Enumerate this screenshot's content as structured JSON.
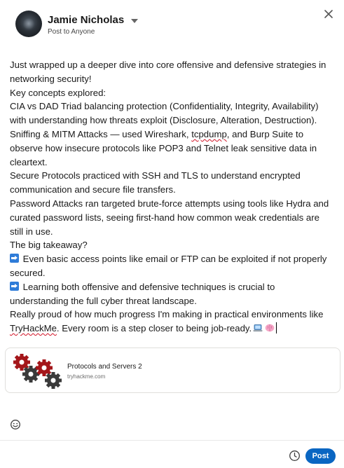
{
  "header": {
    "author_name": "Jamie Nicholas",
    "audience": "Post to Anyone"
  },
  "post": {
    "lines": [
      "Just wrapped up a deeper dive into core offensive and defensive strategies in",
      "networking security!",
      "Key concepts explored:",
      "CIA vs DAD Triad balancing protection (Confidentiality, Integrity, Availability)",
      "with understanding how threats exploit (Disclosure, Alteration, Destruction).",
      "Sniffing & MITM Attacks — used Wireshark, ",
      "tcpdump",
      ", and Burp Suite to",
      "observe how insecure protocols like POP3 and Telnet leak sensitive data in",
      "cleartext.",
      "Secure Protocols practiced with SSH and TLS to understand encrypted",
      "communication and secure file transfers.",
      "Password Attacks ran targeted brute-force attempts using tools like Hydra and",
      "curated password lists, seeing first-hand how common weak credentials are",
      "still in use.",
      "The big takeaway?",
      " Even basic access points like email or FTP can be exploited if not properly",
      "secured.",
      " Learning both offensive and defensive techniques is crucial to",
      "understanding the full cyber threat landscape.",
      "Really proud of how much progress I'm making in practical environments like",
      "TryHackMe",
      ". Every room is a step closer to being job-ready."
    ]
  },
  "link_preview": {
    "title": "Protocols and Servers 2",
    "domain": "tryhackme.com"
  },
  "footer": {
    "post_label": "Post"
  },
  "icons": {
    "close": "close-icon",
    "emoji": "smiley-icon",
    "schedule": "clock-icon",
    "arrow": "right-arrow-emoji",
    "laptop": "laptop-emoji",
    "brain": "brain-emoji",
    "caret": "chevron-down-icon"
  },
  "colors": {
    "accent": "#0a66c2",
    "spellcheck": "#d11124"
  }
}
